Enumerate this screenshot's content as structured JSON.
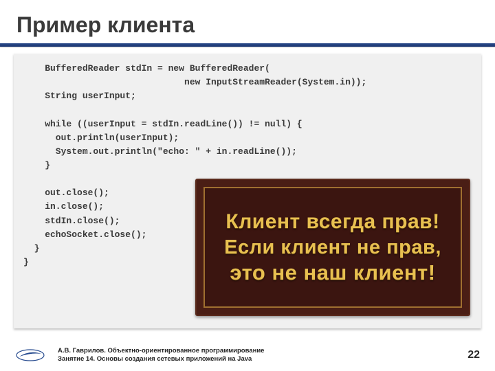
{
  "title": "Пример клиента",
  "code": "    BufferedReader stdIn = new BufferedReader(\n                              new InputStreamReader(System.in));\n    String userInput;\n\n    while ((userInput = stdIn.readLine()) != null) {\n      out.println(userInput);\n      System.out.println(\"echo: \" + in.readLine());\n    }\n\n    out.close();\n    in.close();\n    stdIn.close();\n    echoSocket.close();\n  }\n}",
  "sign": {
    "line1": "Клиент всегда прав!",
    "line2": "Если клиент не прав,",
    "line3": "это не наш клиент!"
  },
  "footer": {
    "line1": "А.В. Гаврилов. Объектно-ориентированное программирование",
    "line2": "Занятие 14. Основы создания сетевых приложений на Java"
  },
  "page_number": "22"
}
